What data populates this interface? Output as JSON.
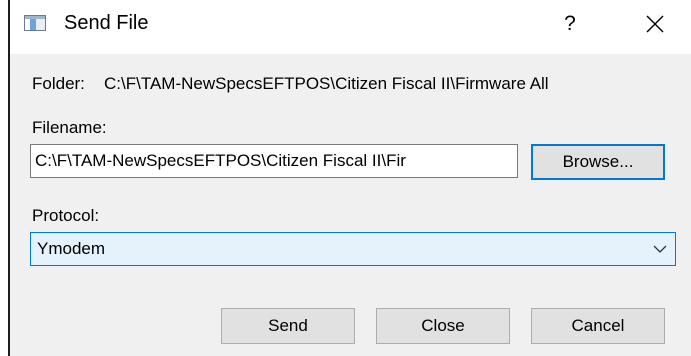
{
  "window": {
    "title": "Send File",
    "help_glyph": "?",
    "icons": {
      "app": "window-app-icon",
      "close": "close-icon",
      "dropdown": "chevron-down-icon"
    }
  },
  "folder": {
    "label": "Folder:",
    "value": "C:\\F\\TAM-NewSpecsEFTPOS\\Citizen Fiscal II\\Firmware All"
  },
  "filename": {
    "label": "Filename:",
    "value": "C:\\F\\TAM-NewSpecsEFTPOS\\Citizen Fiscal II\\Fir"
  },
  "browse": {
    "label": "Browse..."
  },
  "protocol": {
    "label": "Protocol:",
    "selected": "Ymodem"
  },
  "buttons": {
    "send": "Send",
    "close": "Close",
    "cancel": "Cancel"
  },
  "colors": {
    "accent": "#0078d7",
    "dialog_bg": "#f0f0f0",
    "button_bg": "#e1e1e1",
    "select_bg": "#e5f1fb"
  }
}
